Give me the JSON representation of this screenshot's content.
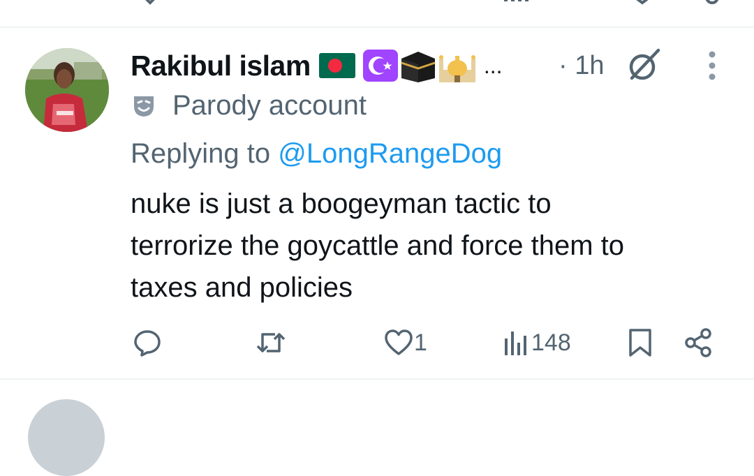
{
  "tweet": {
    "display_name": "Rakibul islam",
    "name_emojis": [
      "bangladesh-flag",
      "star-and-crescent",
      "kaaba",
      "mosque"
    ],
    "name_overflow": "...",
    "timestamp_separator": "·",
    "timestamp": "1h",
    "parody_label": "Parody account",
    "reply_prefix": "Replying to",
    "reply_handle": "@LongRangeDog",
    "text_lines": [
      "nuke is just a boogeyman tactic to",
      "terrorize the goycattle and force them to",
      "taxes and policies"
    ],
    "actions": {
      "reply_count": "",
      "retweet_count": "",
      "like_count": "1",
      "views_count": "148"
    }
  },
  "colors": {
    "text_primary": "#0f1419",
    "text_secondary": "#536471",
    "link": "#1d9bf0",
    "divider": "#eff3f4"
  }
}
